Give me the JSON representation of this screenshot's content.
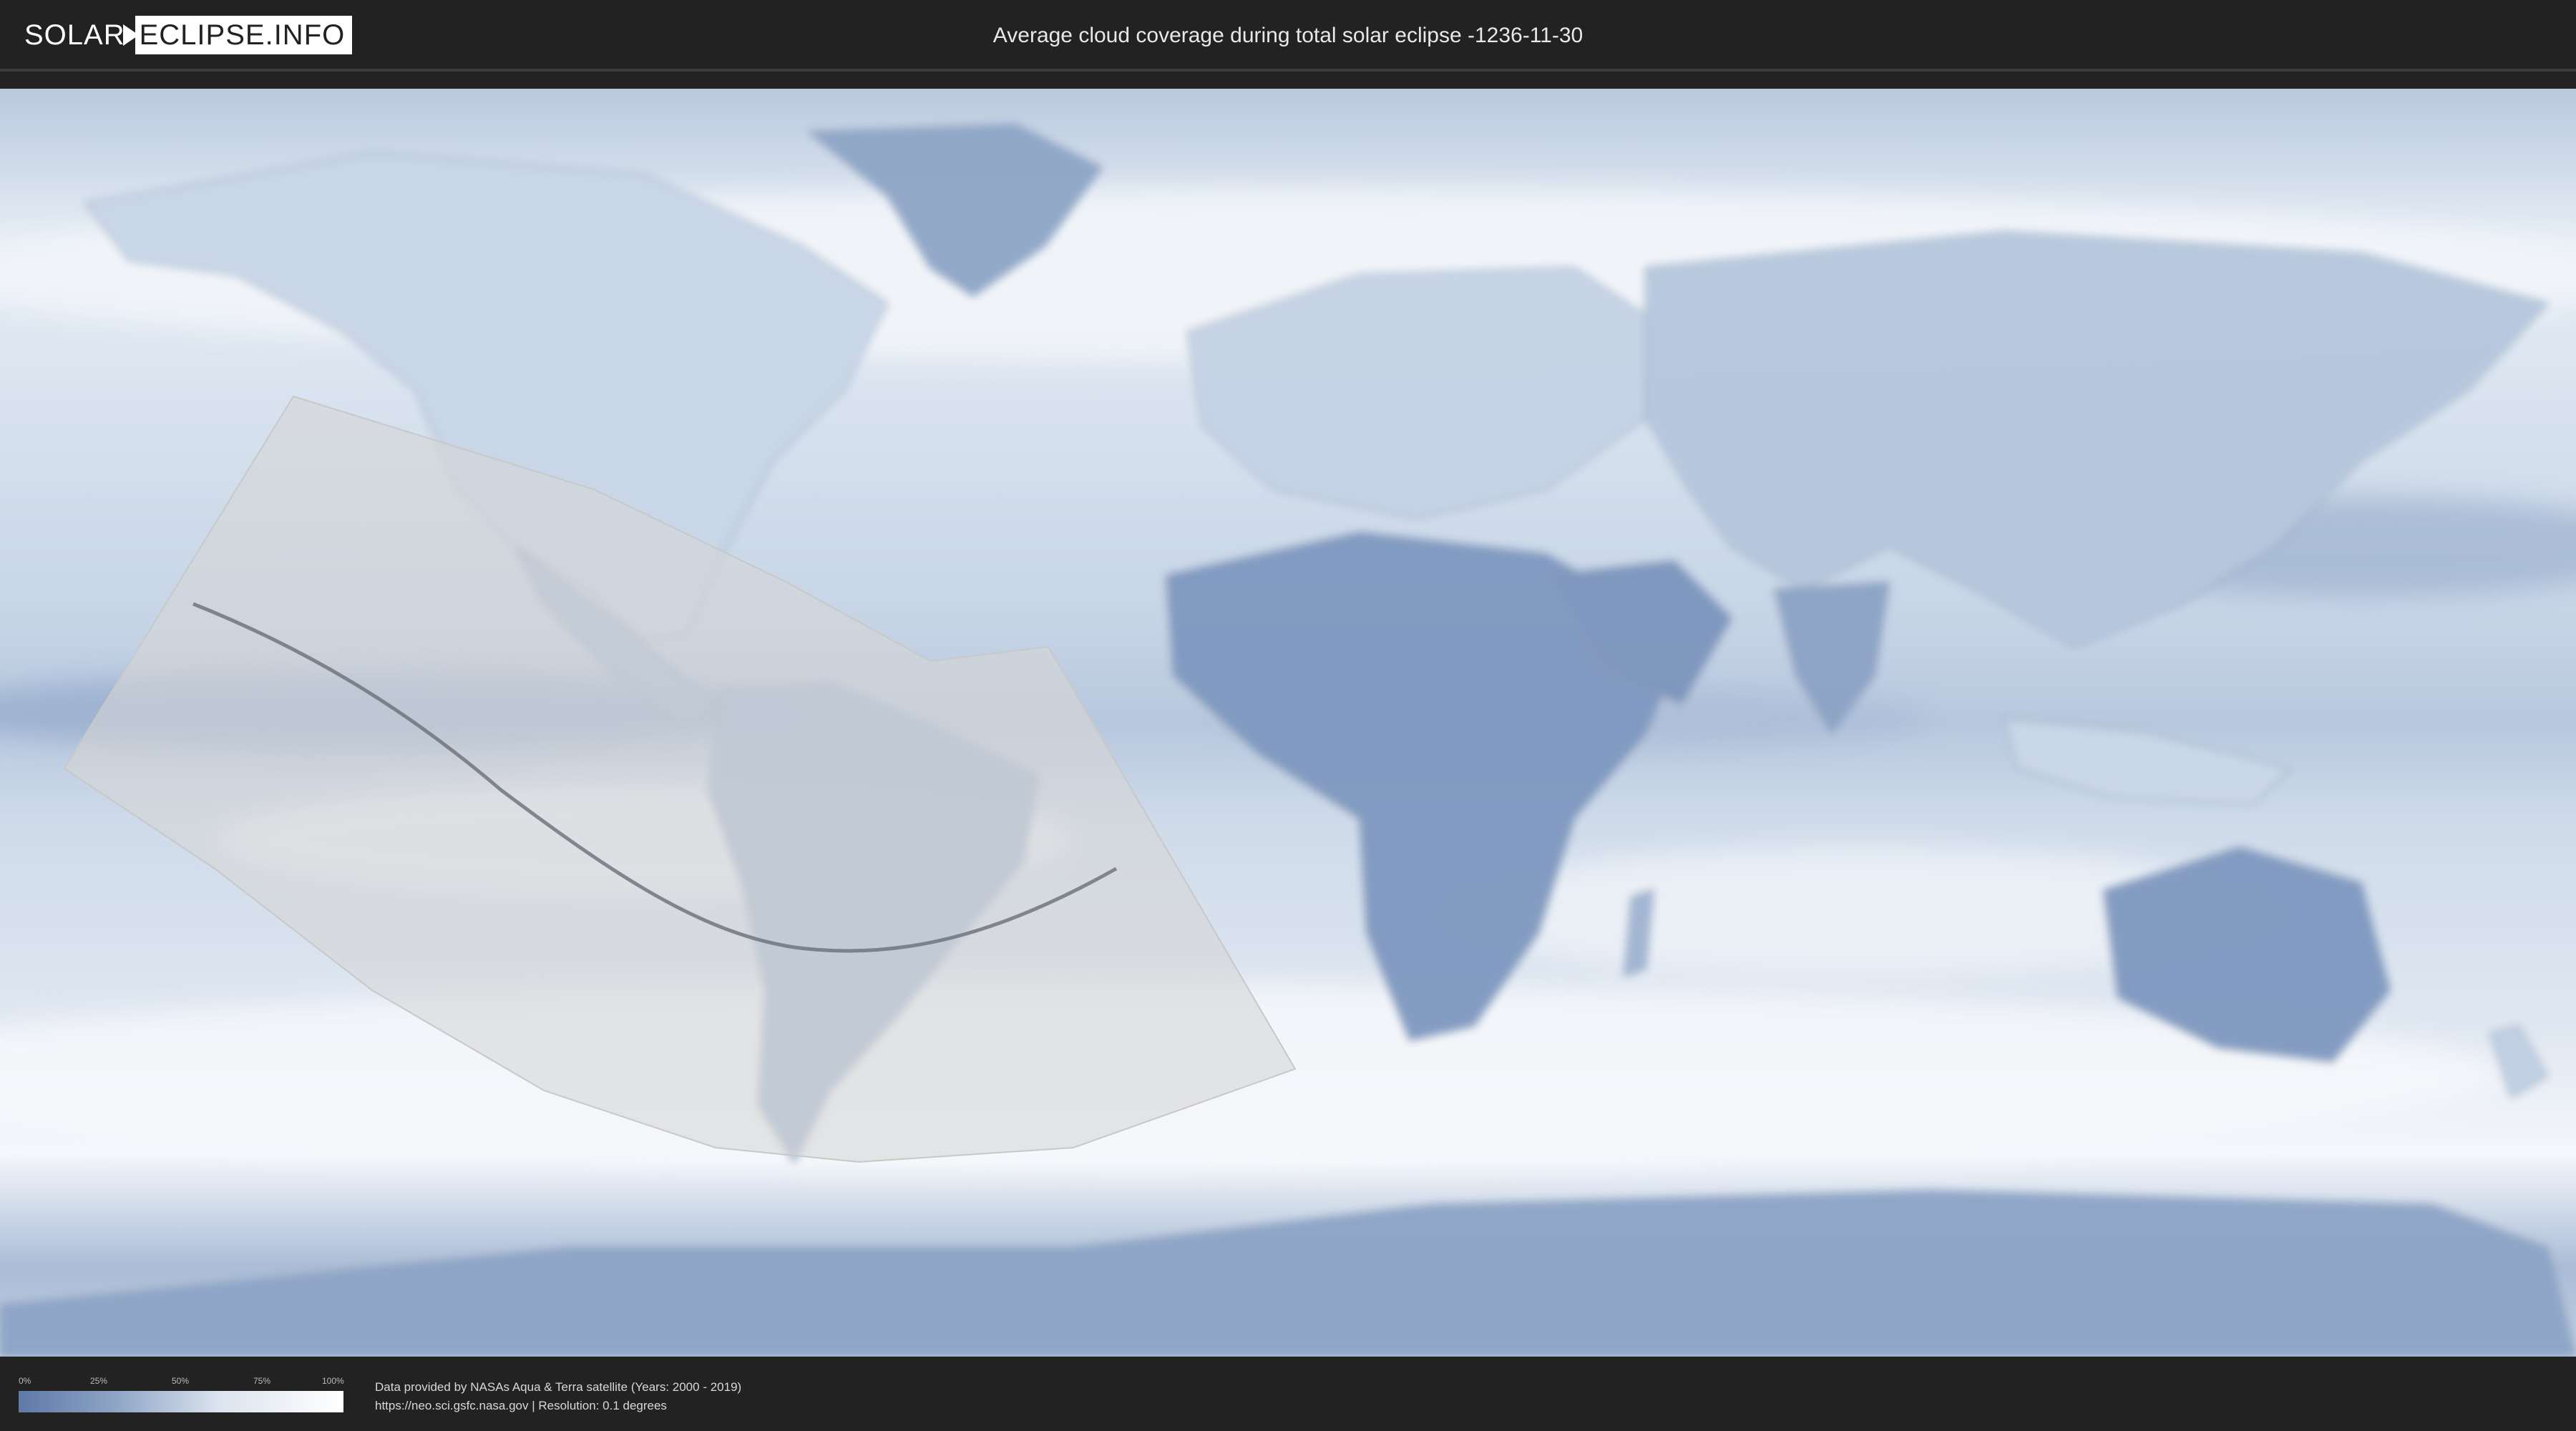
{
  "header": {
    "logo_solar": "SOLAR",
    "logo_eclipse": "ECLIPSE.INFO",
    "title": "Average cloud coverage during total solar eclipse -1236-11-30"
  },
  "map": {
    "icon": "world-cloud-map",
    "colors": {
      "clear_sky": "#5f79a8",
      "mid": "#9fb3d0",
      "overcast": "#ffffff",
      "eclipse_overlay": "#d6d6d6",
      "central_line": "#6a6f78"
    }
  },
  "legend": {
    "ticks": [
      "0%",
      "25%",
      "50%",
      "75%",
      "100%"
    ]
  },
  "footer": {
    "credit_line_1": "Data provided by NASAs Aqua & Terra satellite (Years: 2000 - 2019)",
    "credit_line_2": "https://neo.sci.gsfc.nasa.gov | Resolution: 0.1 degrees"
  }
}
